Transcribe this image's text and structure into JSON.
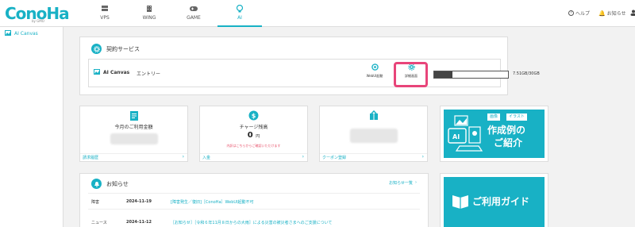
{
  "header": {
    "logo": "ConoHa",
    "logo_sub": "by GMO",
    "tabs": [
      {
        "label": "VPS",
        "icon": "server-icon"
      },
      {
        "label": "WING",
        "icon": "building-icon"
      },
      {
        "label": "GAME",
        "icon": "gamepad-icon"
      },
      {
        "label": "AI",
        "icon": "ai-icon"
      }
    ],
    "help": "ヘルプ",
    "notice": "お知らせ"
  },
  "sidebar": {
    "items": [
      {
        "label": "AI Canvas",
        "icon": "image-icon"
      }
    ]
  },
  "contract": {
    "title": "契約サービス",
    "service_name": "AI Canvas",
    "plan": "エントリー",
    "webui_label": "WebUI起動",
    "settings_label": "詳細画面",
    "storage_text": "7.51GB/30GB",
    "storage_used_fraction": 0.25
  },
  "cards": {
    "billing": {
      "title": "今月のご利用金額",
      "link": "請求履歴"
    },
    "charge": {
      "title": "チャージ残高",
      "amount": "0",
      "unit": "円",
      "note": "内訳はこちらからご確認いただけます",
      "link": "入金"
    },
    "coupon": {
      "link": "クーポン登録"
    }
  },
  "banner": {
    "tag1": "画像",
    "tag2": "イラスト",
    "line1": "作成例の",
    "line2": "ご紹介"
  },
  "news": {
    "title": "お知らせ",
    "more": "お知らせ一覧",
    "items": [
      {
        "category": "障害",
        "date": "2024-11-19",
        "title": "[障害発生／復旧]［ConoHa］WebUI起動不可"
      },
      {
        "category": "ニュース",
        "date": "2024-11-12",
        "title": "［お知らせ］［令和６年11月８日からの大雨］による災害の被災者さまへのご支援について"
      }
    ]
  },
  "guide": {
    "label": "ご利用ガイド"
  },
  "colors": {
    "accent": "#18b1c5",
    "highlight": "#e8457a"
  }
}
